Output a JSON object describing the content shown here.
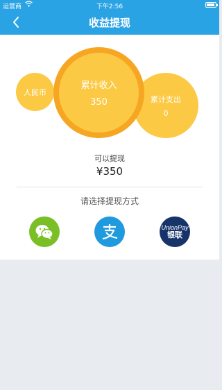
{
  "status_bar": {
    "carrier": "运营商",
    "time": "下午2:56"
  },
  "header": {
    "back_icon": "chevron-left-icon",
    "title": "收益提现",
    "color": "#2aa3e4"
  },
  "summary": {
    "currency_label": "人民币",
    "income_label": "累计收入",
    "income_value": "350",
    "expense_label": "累计支出",
    "expense_value": "0",
    "colors": {
      "circle": "#fbc944",
      "ring": "#f6a623"
    }
  },
  "withdraw": {
    "label": "可以提现",
    "amount": "¥350"
  },
  "methods": {
    "label": "请选择提现方式",
    "items": [
      {
        "name": "wechat",
        "icon": "wechat-icon",
        "color": "#7bbf27"
      },
      {
        "name": "alipay",
        "icon": "alipay-icon",
        "color": "#1f9ade"
      },
      {
        "name": "unionpay",
        "icon": "unionpay-icon",
        "color": "#17346a",
        "text_en": "UnionPay",
        "text_cn": "银联"
      }
    ]
  }
}
